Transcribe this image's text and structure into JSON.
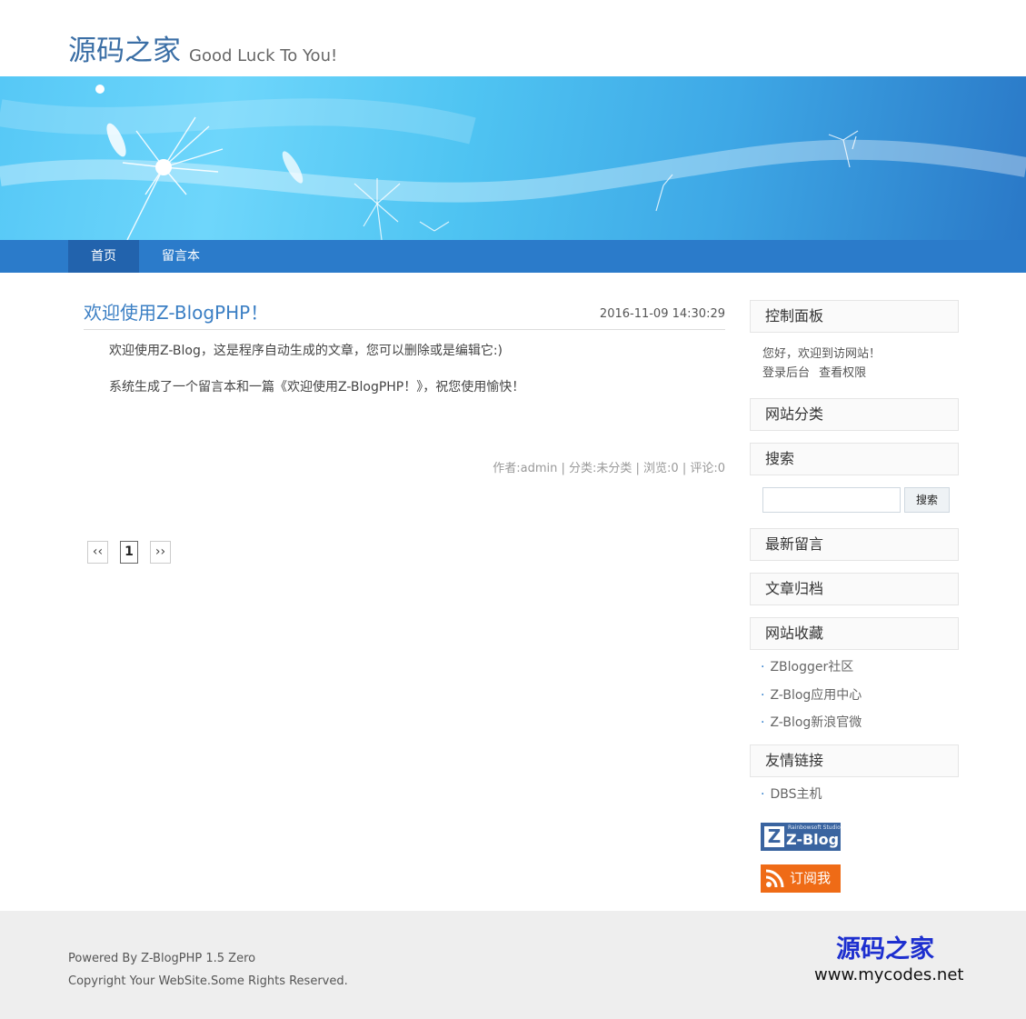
{
  "site": {
    "title": "源码之家",
    "slogan": "Good Luck To You!"
  },
  "nav": {
    "items": [
      {
        "label": "首页"
      },
      {
        "label": "留言本"
      }
    ]
  },
  "post": {
    "title": "欢迎使用Z-BlogPHP！",
    "date": "2016-11-09 14:30:29",
    "paragraphs": [
      "欢迎使用Z-Blog，这是程序自动生成的文章，您可以删除或是编辑它:)",
      "系统生成了一个留言本和一篇《欢迎使用Z-BlogPHP！》，祝您使用愉快！"
    ],
    "meta": "作者:admin | 分类:未分类 | 浏览:0 | 评论:0"
  },
  "pager": {
    "prev": "‹‹",
    "current": "1",
    "next": "››"
  },
  "sidebar": {
    "control_panel": {
      "title": "控制面板",
      "greeting": "您好，欢迎到访网站！",
      "login": "登录后台",
      "permissions": "查看权限"
    },
    "categories": {
      "title": "网站分类"
    },
    "search": {
      "title": "搜索",
      "button": "搜索",
      "value": ""
    },
    "latest_comments": {
      "title": "最新留言"
    },
    "archives": {
      "title": "文章归档"
    },
    "favorites": {
      "title": "网站收藏",
      "links": [
        "ZBlogger社区",
        "Z-Blog应用中心",
        "Z-Blog新浪官微"
      ]
    },
    "friend_links": {
      "title": "友情链接",
      "links": [
        "DBS主机"
      ]
    },
    "zblog_badge": {
      "small": "Rainbowsoft Studio",
      "text": "Z-Blog"
    },
    "rss_badge": {
      "label": "订阅我",
      "icon": "rss-icon"
    }
  },
  "footer": {
    "powered": "Powered By Z-BlogPHP 1.5 Zero",
    "copyright": "Copyright Your WebSite.Some Rights Reserved."
  },
  "watermark": {
    "cn": "源码之家",
    "url": "www.mycodes.net"
  },
  "colors": {
    "accent": "#2b7bca",
    "nav_active": "#2263ad",
    "title_link": "#3b7fc4",
    "footer_bg": "#eeeeee",
    "rss": "#ef6b16",
    "zblog": "#3a64a0"
  }
}
